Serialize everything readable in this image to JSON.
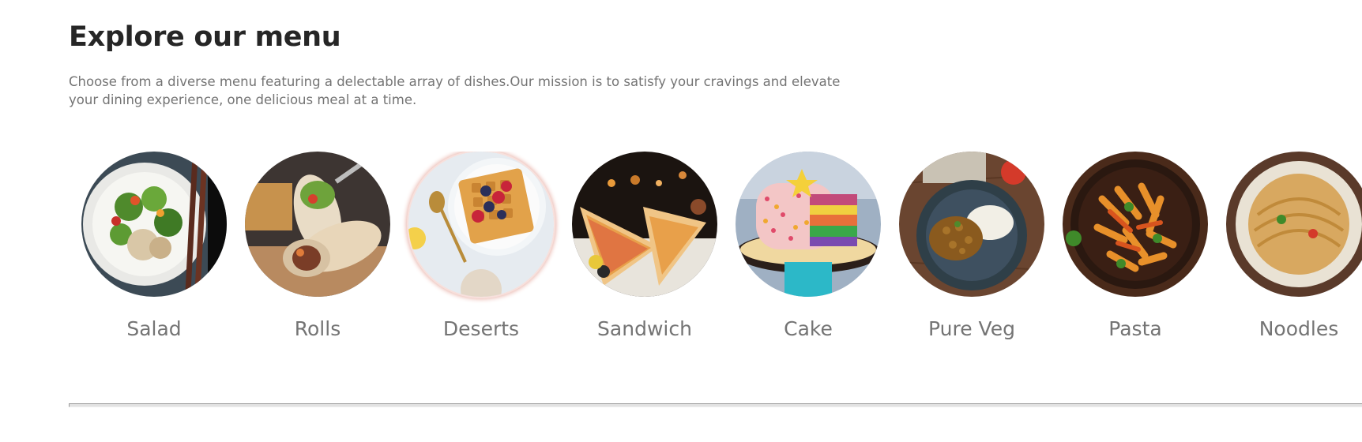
{
  "explore": {
    "title": "Explore our menu",
    "description": "Choose from a diverse menu featuring a delectable array of dishes.Our mission is to satisfy your cravings and elevate your dining experience, one delicious meal at a time."
  },
  "menu": {
    "items": [
      {
        "label": "Salad",
        "icon": "salad-image",
        "active": false
      },
      {
        "label": "Rolls",
        "icon": "rolls-image",
        "active": false
      },
      {
        "label": "Deserts",
        "icon": "deserts-image",
        "active": true
      },
      {
        "label": "Sandwich",
        "icon": "sandwich-image",
        "active": false
      },
      {
        "label": "Cake",
        "icon": "cake-image",
        "active": false
      },
      {
        "label": "Pure Veg",
        "icon": "pure-veg-image",
        "active": false
      },
      {
        "label": "Pasta",
        "icon": "pasta-image",
        "active": false
      },
      {
        "label": "Noodles",
        "icon": "noodles-image",
        "active": false
      }
    ]
  },
  "colors": {
    "heading": "#262626",
    "text": "#747474",
    "divider": "#e2e2e2",
    "active_ring": "#e9b3aa"
  }
}
